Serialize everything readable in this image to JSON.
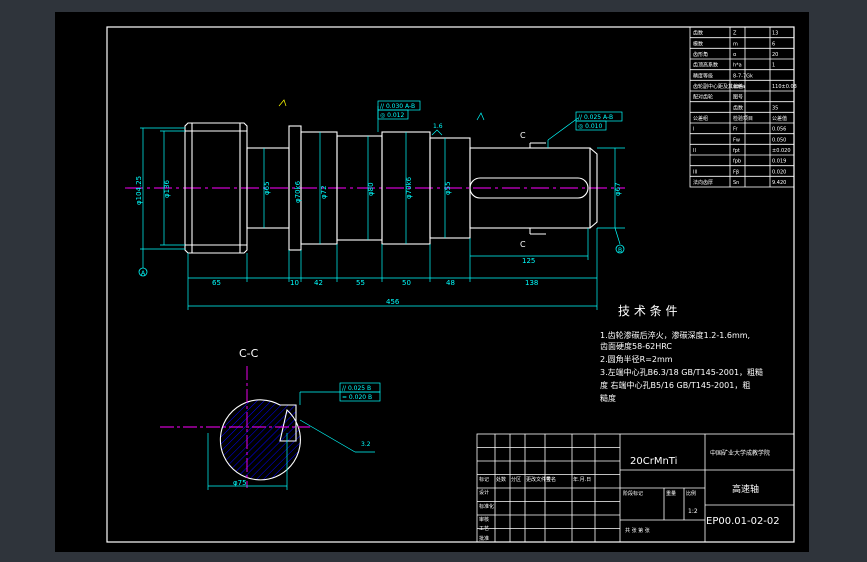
{
  "drawing": {
    "background": "#000000",
    "frame_color": "#ffffff",
    "cyan": "#00ffff",
    "magenta": "#ff00ff",
    "blue": "#0000ff",
    "yellow": "#ffff00"
  },
  "param_table": {
    "rows": [
      [
        "齿数",
        "Z",
        "13"
      ],
      [
        "模数",
        "m",
        "6"
      ],
      [
        "齿形角",
        "α",
        "20"
      ],
      [
        "齿顶高系数",
        "h*a",
        "1"
      ],
      [
        "精度等级",
        "8-7-7Gk",
        ""
      ],
      [
        "齿轮副中心距及其偏差",
        "a±fa",
        "110±0.03"
      ],
      [
        "配对齿轮",
        "图号",
        ""
      ],
      [
        "",
        "齿数",
        "35"
      ],
      [
        "公差组",
        "检验项目",
        "公差值"
      ],
      [
        "I",
        "Fr",
        "0.056"
      ],
      [
        "",
        "Fw",
        "0.050"
      ],
      [
        "II",
        "fpt",
        "±0.020"
      ],
      [
        "",
        "fpb",
        "0.019"
      ],
      [
        "III",
        "Fβ",
        "0.020"
      ],
      [
        "法向齿厚",
        "Sn",
        "9.420"
      ]
    ]
  },
  "dims": {
    "bottom": [
      "65",
      "10",
      "42",
      "55",
      "50",
      "48",
      "138"
    ],
    "total": "456",
    "keyway_len": "125",
    "keyway_w": "18",
    "dia_gear": "φ104.25",
    "dia_root": "φ136",
    "dia_1": "φ65",
    "dia_2": "φ70k6",
    "dia_3": "φ72",
    "dia_4": "φ80",
    "dia_5": "φ70k6",
    "dia_6": "φ55",
    "dia_7": "φ67",
    "section_dia": "φ75",
    "roughness_a": "1.6",
    "roughness_b": "3.2"
  },
  "gdt": {
    "left_1": "// 0.030 A-B",
    "left_2": "◎ 0.012",
    "right_1": "// 0.025 A-B",
    "right_2": "◎ 0.010",
    "sec_1": "// 0.025 B",
    "sec_2": "= 0.020 B"
  },
  "datums": {
    "a": "A",
    "b": "B"
  },
  "section_marks": {
    "top": "C",
    "bottom": "C"
  },
  "section_title": "C-C",
  "tech": {
    "title": "技 术 条 件",
    "lines": [
      "1.齿轮渗碳后淬火，渗碳深度1.2-1.6mm,",
      "齿面硬度58-62HRC",
      "2.圆角半径R=2mm",
      "3.左端中心孔B6.3/18 GB/T145-2001，粗糙",
      "度    右端中心孔B5/16 GB/T145-2001，粗",
      "糙度"
    ]
  },
  "title_block": {
    "material": "20CrMnTi",
    "school": "中国矿业大学成教学院",
    "part_name": "高速轴",
    "drawing_no": "EP00.01-02-02",
    "scale": "1:2",
    "col_labels": [
      "标记",
      "处数",
      "分区",
      "更改文件号",
      "签名",
      "年.月.日"
    ],
    "row_labels": [
      "设计",
      "标准化",
      "审核",
      "工艺",
      "批准"
    ],
    "stage_labels": [
      "阶段标记",
      "重量",
      "比例"
    ],
    "sheet": "共  张  第  张"
  }
}
